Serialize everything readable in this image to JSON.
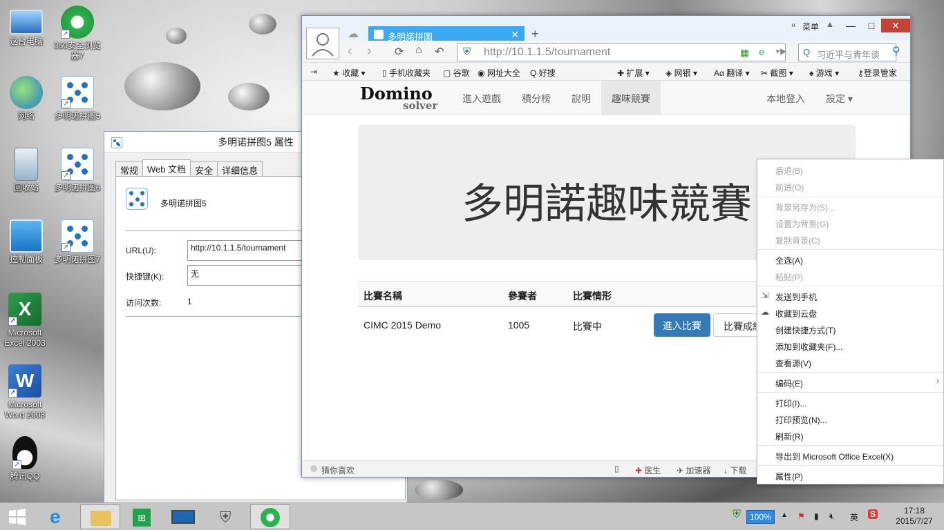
{
  "desktop_icons": [
    {
      "label": "这台电脑",
      "icon": "computer-icon"
    },
    {
      "label": "360安全浏览器7",
      "icon": "browser-360-icon"
    },
    {
      "label": "网络",
      "icon": "network-icon"
    },
    {
      "label": "多明诺拼图5",
      "icon": "domino-icon"
    },
    {
      "label": "回收站",
      "icon": "recycle-bin-icon"
    },
    {
      "label": "多明诺拼图6",
      "icon": "domino-icon"
    },
    {
      "label": "控制面板",
      "icon": "control-panel-icon"
    },
    {
      "label": "多明诺拼图7",
      "icon": "domino-icon"
    },
    {
      "label": "Microsoft Excel 2003",
      "icon": "excel-icon"
    },
    {
      "label": "Microsoft Word 2003",
      "icon": "word-icon"
    },
    {
      "label": "腾讯QQ",
      "icon": "qq-icon"
    }
  ],
  "props": {
    "title": "多明诺拼图5 属性",
    "tabs": [
      "常规",
      "Web 文档",
      "安全",
      "详细信息"
    ],
    "name": "多明诺拼图5",
    "url_label": "URL(U):",
    "url_value": "http://10.1.1.5/tournament",
    "hotkey_label": "快捷键(K):",
    "hotkey_value": "无",
    "visits_label": "访问次数:",
    "visits_value": "1"
  },
  "browser": {
    "tab_title": "多明諾拼圖",
    "menu_label": "菜单",
    "url": "http://10.1.1.5/tournament",
    "search_placeholder": "习近平与青年谈",
    "favorites": [
      "收藏",
      "手机收藏夹",
      "谷歌",
      "网址大全",
      "好搜",
      "扩展",
      "网银",
      "翻译",
      "截图",
      "游戏",
      "登录管家"
    ],
    "site": {
      "logo_main": "Domino",
      "logo_sub": "solver",
      "nav": [
        "進入遊戲",
        "積分榜",
        "說明",
        "趣味競賽"
      ],
      "nav_active": "趣味競賽",
      "login": "本地登入",
      "settings": "設定",
      "hero": "多明諾趣味競賽",
      "table_headers": [
        "比賽名稱",
        "參賽者",
        "比賽情形"
      ],
      "rows": [
        {
          "name": "CIMC 2015 Demo",
          "players": "1005",
          "status": "比賽中",
          "enter": "進入比賽",
          "result": "比賽成績"
        }
      ]
    },
    "statusbar": {
      "left": "猜你喜欢",
      "doctor": "医生",
      "accelerator": "加速器",
      "download": "下载"
    }
  },
  "context_menu": {
    "items": [
      {
        "label": "后退(B)",
        "disabled": true
      },
      {
        "label": "前进(O)",
        "disabled": true
      },
      {
        "label": "背景另存为(S)...",
        "disabled": true
      },
      {
        "label": "设置为背景(G)",
        "disabled": true
      },
      {
        "label": "复制背景(C)",
        "disabled": true
      },
      {
        "label": "全选(A)",
        "disabled": false
      },
      {
        "label": "粘贴(P)",
        "disabled": true
      },
      {
        "label": "发送到手机",
        "disabled": false
      },
      {
        "label": "收藏到云盘",
        "disabled": false
      },
      {
        "label": "创建快捷方式(T)",
        "disabled": false
      },
      {
        "label": "添加到收藏夹(F)...",
        "disabled": false
      },
      {
        "label": "查看源(V)",
        "disabled": false
      },
      {
        "label": "编码(E)",
        "disabled": false
      },
      {
        "label": "打印(I)...",
        "disabled": false
      },
      {
        "label": "打印预览(N)...",
        "disabled": false
      },
      {
        "label": "刷新(R)",
        "disabled": false
      },
      {
        "label": "导出到 Microsoft Office Excel(X)",
        "disabled": false
      },
      {
        "label": "属性(P)",
        "disabled": false
      }
    ]
  },
  "taskbar": {
    "battery": "100%",
    "ime": "英",
    "time": "17:18",
    "date": "2015/7/27"
  },
  "colors": {
    "browser_tab": "#39a9f3",
    "primary_button": "#337ab7",
    "taskbar": "#c6c6c6"
  }
}
